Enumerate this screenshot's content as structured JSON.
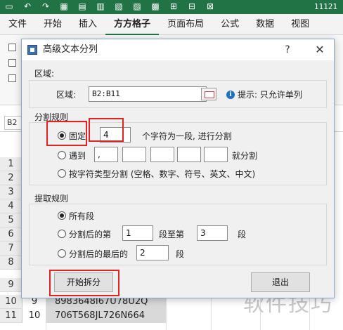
{
  "excel": {
    "titlebar_number": "11121",
    "tabs": [
      "文件",
      "开始",
      "插入",
      "方方格子",
      "页面布局",
      "公式",
      "数据",
      "视图"
    ],
    "active_tab_index": 3,
    "name_box": "B2",
    "rows": [
      {
        "num": "1",
        "a": "",
        "b": ""
      },
      {
        "num": "2",
        "a": "",
        "b": ""
      },
      {
        "num": "3",
        "a": "",
        "b": ""
      },
      {
        "num": "4",
        "a": "",
        "b": ""
      },
      {
        "num": "5",
        "a": "",
        "b": ""
      },
      {
        "num": "6",
        "a": "",
        "b": ""
      },
      {
        "num": "7",
        "a": "",
        "b": ""
      },
      {
        "num": "8",
        "a": "",
        "b": ""
      },
      {
        "num": "9",
        "a": "",
        "b": ""
      },
      {
        "num": "10",
        "a": "9",
        "b": "8983648I67U78U2Q"
      },
      {
        "num": "11",
        "a": "10",
        "b": "706T568JL726N664"
      }
    ]
  },
  "dialog": {
    "title": "高级文本分列",
    "help": "?",
    "close": "✕",
    "region": {
      "group_title": "区域:",
      "label": "区域:",
      "value": "B2:B11",
      "hint": "提示: 只允许单列"
    },
    "split_rule": {
      "group_title": "分割规则",
      "fixed_label": "固定",
      "fixed_value": "4",
      "fixed_suffix": "个字符为一段, 进行分割",
      "meet_label": "遇到",
      "meet_values": [
        ",",
        "",
        "",
        "",
        ""
      ],
      "meet_suffix": "就分割",
      "by_type_label": "按字符类型分割 (空格、数字、符号、英文、中文)",
      "selected": "fixed"
    },
    "extract_rule": {
      "group_title": "提取规则",
      "all_label": "所有段",
      "after_label": "分割后的第",
      "after_from": "1",
      "after_mid": "段至第",
      "after_to": "3",
      "after_suffix": "段",
      "last_label": "分割后的最后的",
      "last_value": "2",
      "last_suffix": "段",
      "selected": "all"
    },
    "start_button": "开始拆分",
    "exit_button": "退出"
  },
  "watermark": "软件技巧"
}
